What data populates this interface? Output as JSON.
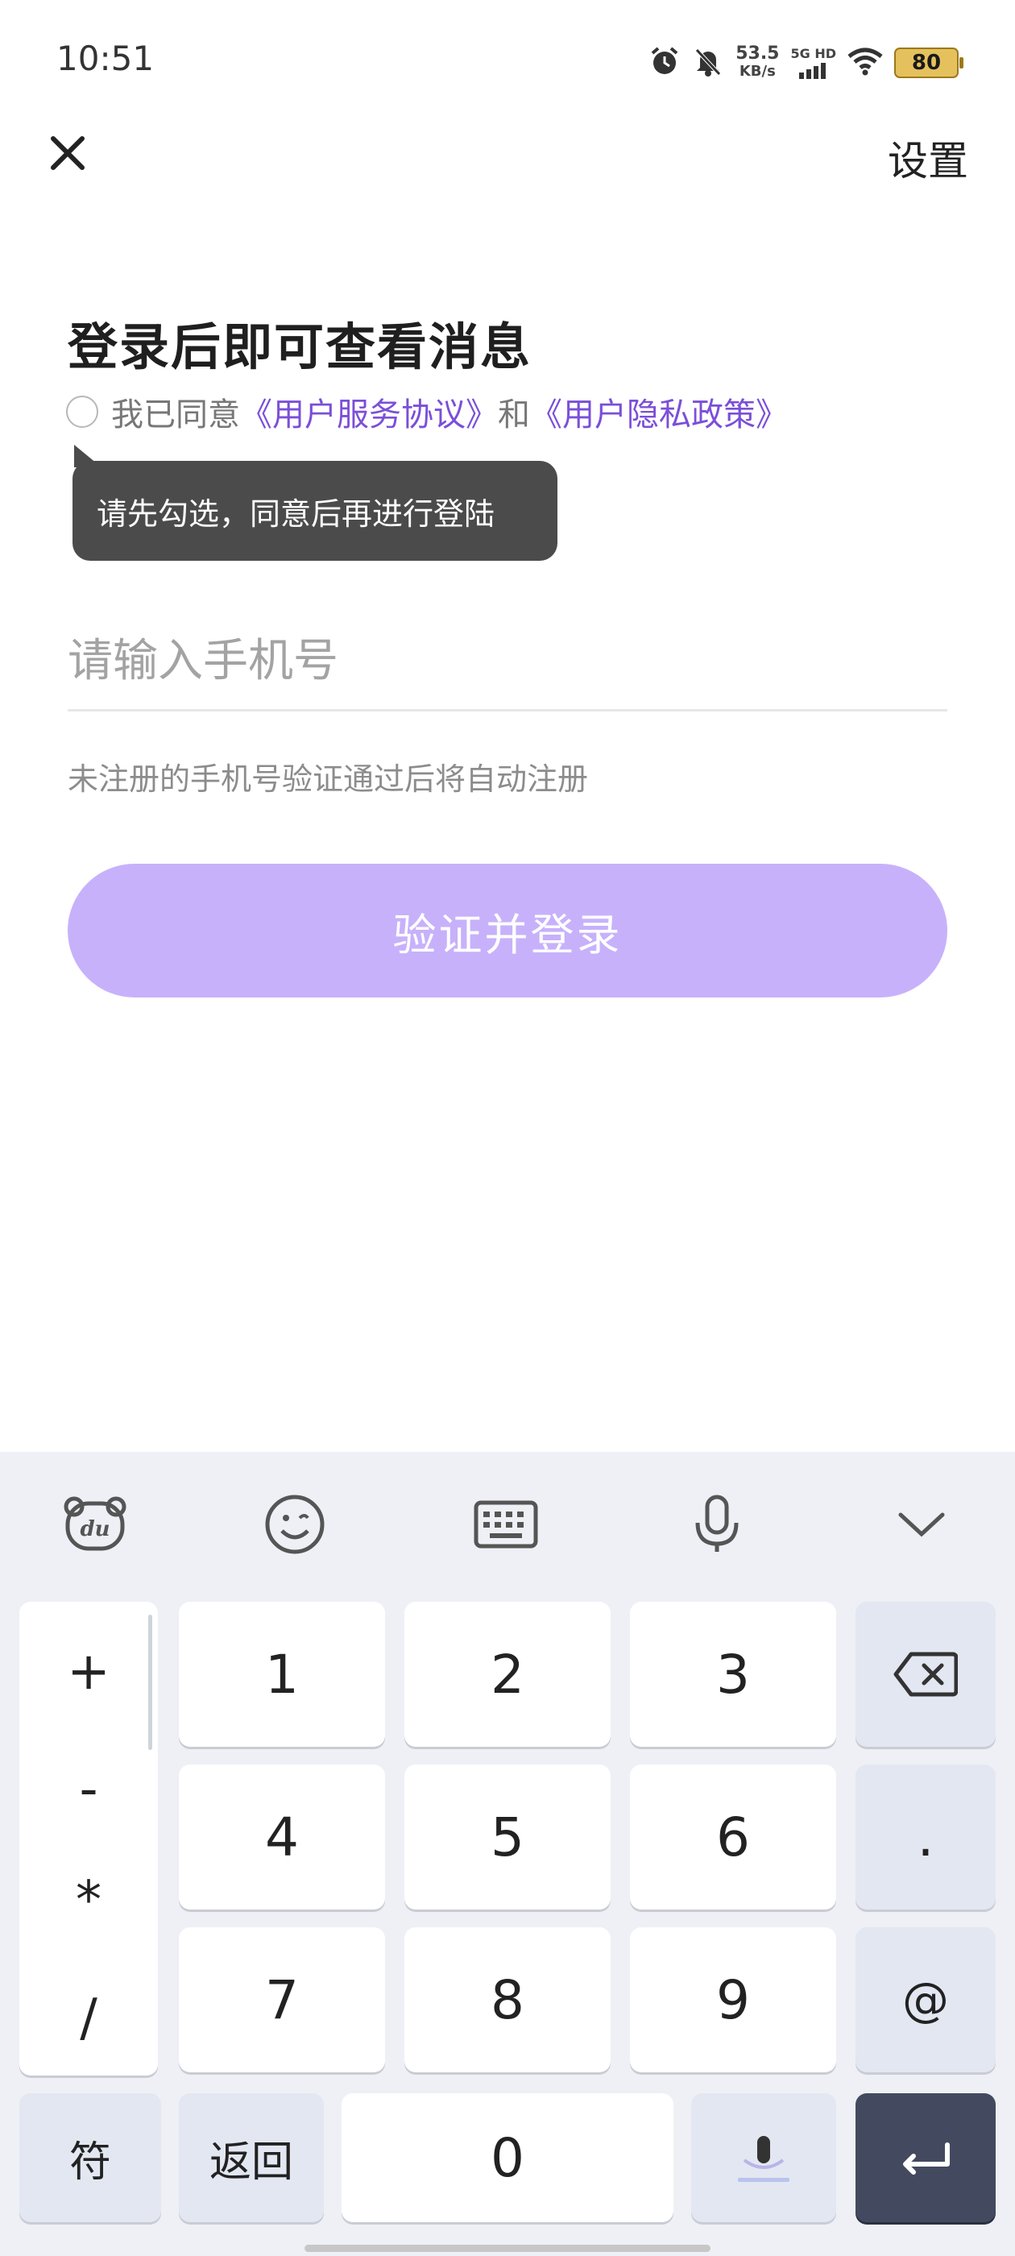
{
  "status_bar": {
    "time": "10:51",
    "net_speed_value": "53.5",
    "net_speed_unit": "KB/s",
    "network_label": "5G HD",
    "battery_level": "80"
  },
  "header": {
    "settings_label": "设置"
  },
  "login": {
    "title": "登录后即可查看消息",
    "agree_prefix": "我已同意",
    "user_agreement": "《用户服务协议》",
    "and": "和",
    "privacy_policy": "《用户隐私政策》",
    "tooltip": "请先勾选，同意后再进行登陆",
    "phone_placeholder": "请输入手机号",
    "phone_value": "",
    "hint": "未注册的手机号验证通过后将自动注册",
    "submit_label": "验证并登录"
  },
  "keyboard": {
    "symbols": [
      "+",
      "-",
      "*",
      "/"
    ],
    "digits": [
      "1",
      "2",
      "3",
      "4",
      "5",
      "6",
      "7",
      "8",
      "9",
      "0"
    ],
    "dot": ".",
    "at": "@",
    "symbol_switch": "符",
    "back": "返回"
  },
  "colors": {
    "accent": "#7b4fd8",
    "button_disabled": "#c7b1fb",
    "tooltip_bg": "#4b4b4b",
    "enter_key": "#434a5f"
  },
  "icons": {
    "close": "close-icon",
    "alarm": "alarm-icon",
    "mute": "bell-off-icon",
    "wifi": "wifi-icon",
    "battery": "battery-icon",
    "keyboard_logo": "du-bear-icon",
    "emoji": "emoji-icon",
    "keyboard": "keyboard-icon",
    "mic": "mic-icon",
    "collapse": "chevron-down-icon",
    "backspace": "backspace-icon",
    "enter": "enter-icon",
    "voice": "voice-input-icon"
  }
}
